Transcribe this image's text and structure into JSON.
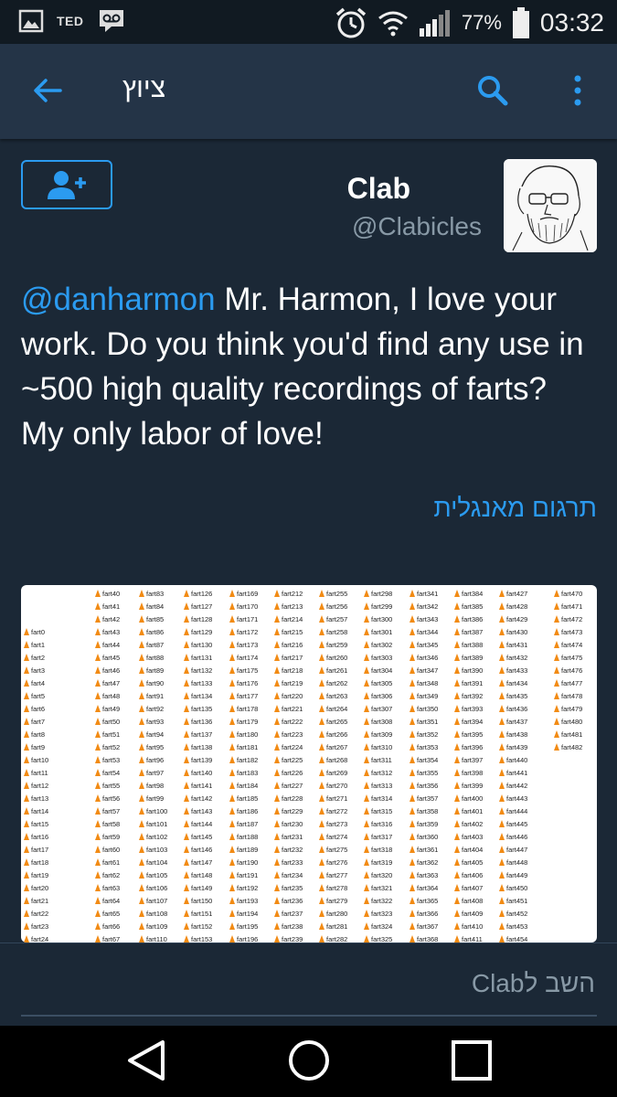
{
  "status_bar": {
    "carrier": "TED",
    "battery": "77%",
    "time": "03:32",
    "icons": [
      "gallery-icon",
      "voicemail-icon",
      "alarm-icon",
      "wifi-icon",
      "signal-icon",
      "battery-icon"
    ]
  },
  "toolbar": {
    "title": "ציוץ",
    "icons": [
      "back-arrow-icon",
      "search-icon",
      "overflow-menu-icon"
    ]
  },
  "tweet": {
    "name": "Clab",
    "handle": "@Clabicles",
    "mention": "@danharmon",
    "text": " Mr. Harmon, I love your work. Do you think you'd find any use in ~500 high quality recordings of farts? My only labor of love!",
    "translate_label": "תרגום מאנגלית"
  },
  "media": {
    "file_prefix": "fart",
    "columns": [
      {
        "start": 0,
        "end": 24,
        "first_row": 3
      },
      {
        "start": 40,
        "end": 67,
        "first_row": 0
      },
      {
        "start": 83,
        "end": 110,
        "first_row": 0
      },
      {
        "start": 126,
        "end": 153,
        "first_row": 0
      },
      {
        "start": 169,
        "end": 196,
        "first_row": 0
      },
      {
        "start": 212,
        "end": 239,
        "first_row": 0
      },
      {
        "start": 255,
        "end": 282,
        "first_row": 0
      },
      {
        "start": 298,
        "end": 325,
        "first_row": 0
      },
      {
        "start": 341,
        "end": 368,
        "first_row": 0
      },
      {
        "start": 384,
        "end": 411,
        "first_row": 0
      },
      {
        "start": 427,
        "end": 454,
        "first_row": 0
      },
      {
        "start": 470,
        "end": 482,
        "first_row": 0
      }
    ]
  },
  "reply": {
    "placeholder": "השב לClab"
  },
  "nav": {
    "icons": [
      "back-triangle-icon",
      "home-circle-icon",
      "recents-square-icon"
    ]
  }
}
